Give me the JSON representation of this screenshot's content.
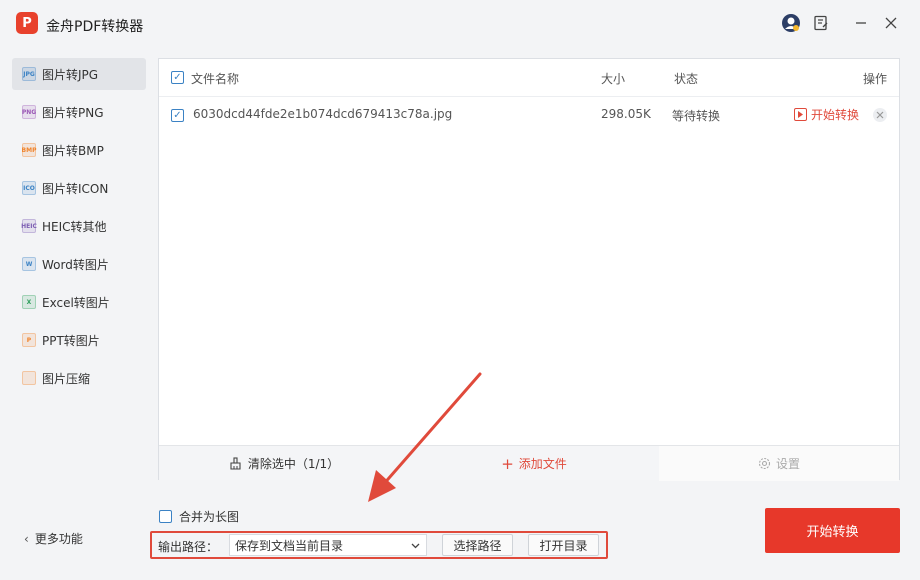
{
  "app": {
    "logo_text": "P",
    "title": "金舟PDF转换器"
  },
  "sidebar": {
    "items": [
      {
        "label": "图片转JPG",
        "icon": "jpg-icon",
        "badge": "JPG",
        "color": "#3b82c4",
        "active": true
      },
      {
        "label": "图片转PNG",
        "icon": "png-icon",
        "badge": "PNG",
        "color": "#9b59b6",
        "active": false
      },
      {
        "label": "图片转BMP",
        "icon": "bmp-icon",
        "badge": "BMP",
        "color": "#f0832a",
        "active": false
      },
      {
        "label": "图片转ICON",
        "icon": "ico-icon",
        "badge": "ICO",
        "color": "#3b82c4",
        "active": false
      },
      {
        "label": "HEIC转其他",
        "icon": "heic-icon",
        "badge": "HEIC",
        "color": "#7d5fb3",
        "active": false
      },
      {
        "label": "Word转图片",
        "icon": "word-icon",
        "badge": "W",
        "color": "#3b82c4",
        "active": false
      },
      {
        "label": "Excel转图片",
        "icon": "excel-icon",
        "badge": "X",
        "color": "#2e9e5b",
        "active": false
      },
      {
        "label": "PPT转图片",
        "icon": "ppt-icon",
        "badge": "P",
        "color": "#f0832a",
        "active": false
      },
      {
        "label": "图片压缩",
        "icon": "compress-icon",
        "badge": "",
        "color": "#f0832a",
        "active": false
      }
    ],
    "more_label": "更多功能"
  },
  "table": {
    "headers": {
      "name": "文件名称",
      "size": "大小",
      "status": "状态",
      "action": "操作"
    },
    "rows": [
      {
        "name": "6030dcd44fde2e1b074dcd679413c78a.jpg",
        "size": "298.05K",
        "status": "等待转换",
        "action": "开始转换",
        "checked": true
      }
    ]
  },
  "footer": {
    "clear_label": "清除选中（1/1）",
    "add_label": "添加文件",
    "settings_label": "设置"
  },
  "options": {
    "merge_label": "合并为长图"
  },
  "output": {
    "label": "输出路径：",
    "selected": "保存到文档当前目录",
    "choose_label": "选择路径",
    "open_label": "打开目录"
  },
  "start_button": "开始转换",
  "colors": {
    "accent": "#e7382a",
    "primary": "#3b82c4",
    "highlight": "#e04a3b"
  }
}
